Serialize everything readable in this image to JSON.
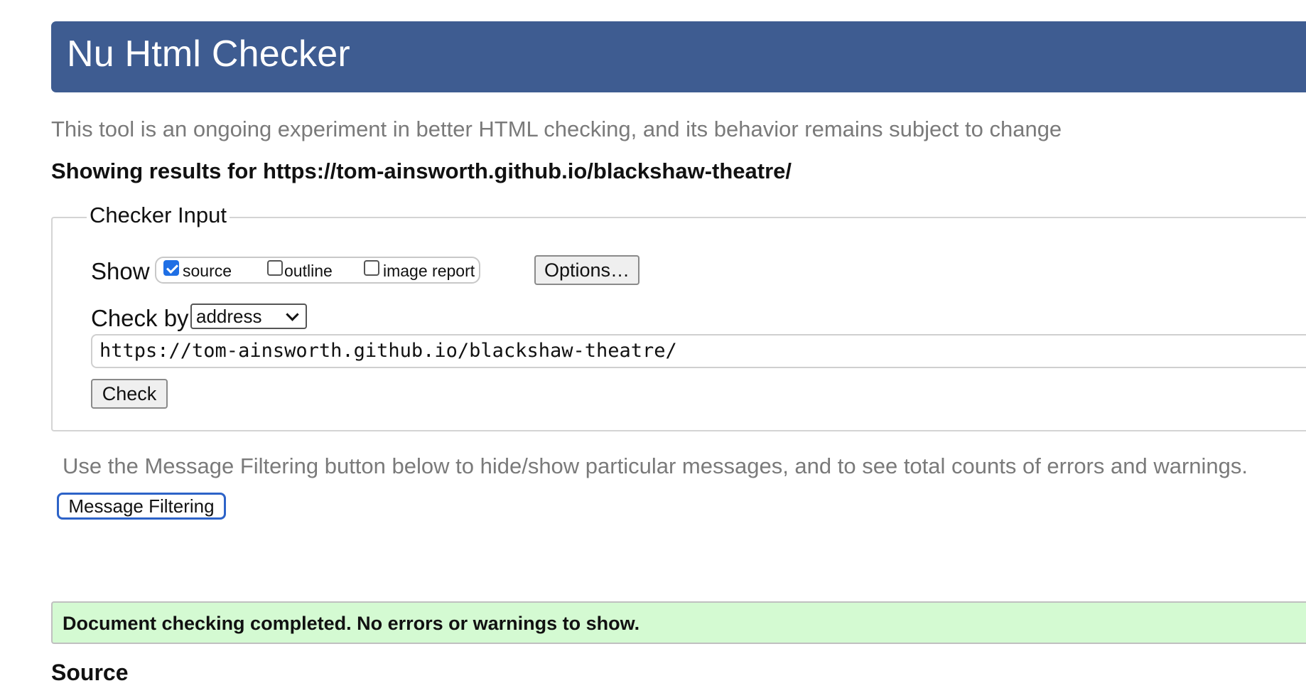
{
  "header": {
    "title": "Nu Html Checker"
  },
  "tagline": "This tool is an ongoing experiment in better HTML checking, and its behavior remains subject to change",
  "results_heading": "Showing results for https://tom-ainsworth.github.io/blackshaw-theatre/",
  "checker_input": {
    "legend": "Checker Input",
    "show_label": "Show",
    "show_options": [
      {
        "label": "source",
        "checked": true
      },
      {
        "label": "outline",
        "checked": false
      },
      {
        "label": "image report",
        "checked": false
      }
    ],
    "options_button": "Options…",
    "check_by_label": "Check by",
    "check_by_value": "address",
    "url_value": "https://tom-ainsworth.github.io/blackshaw-theatre/",
    "check_button": "Check"
  },
  "filter": {
    "hint": "Use the Message Filtering button below to hide/show particular messages, and to see total counts of errors and warnings.",
    "button": "Message Filtering"
  },
  "status": {
    "message": "Document checking completed. No errors or warnings to show."
  },
  "source_heading": "Source",
  "colors": {
    "banner": "#3e5c91",
    "success_bg": "#d4fad2",
    "focus_ring": "#2d63c8",
    "checkbox_checked": "#1f6fe5"
  }
}
